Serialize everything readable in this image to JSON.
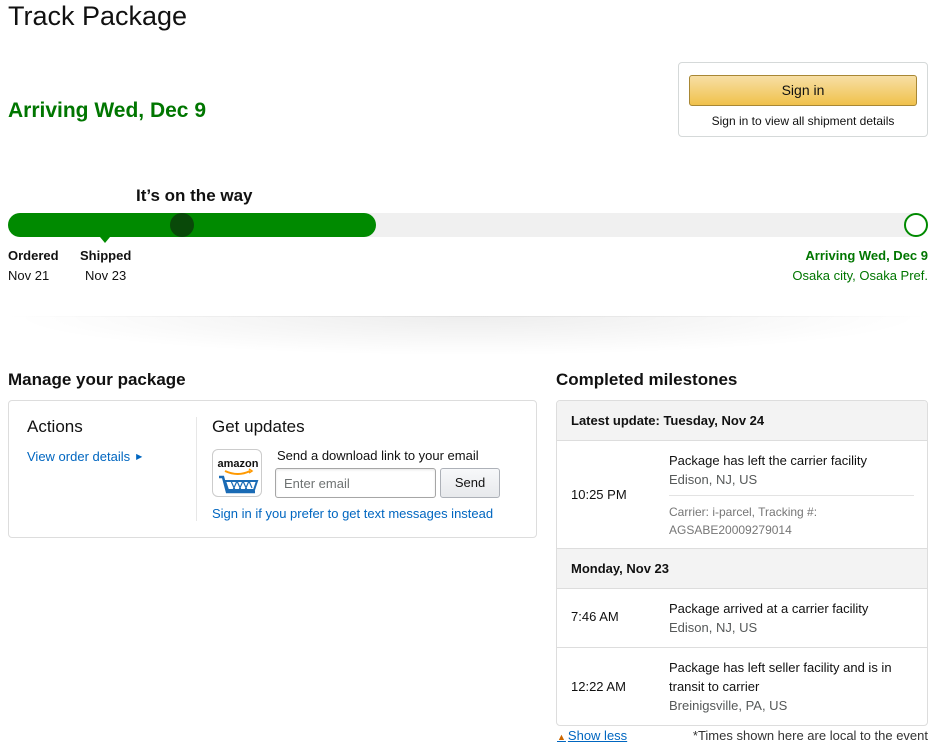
{
  "header": {
    "title": "Track Package",
    "arriving": "Arriving Wed, Dec 9"
  },
  "signin": {
    "button_label": "Sign in",
    "hint": "Sign in to view all shipment details"
  },
  "progress": {
    "status": "It’s on the way",
    "fill_fraction": 0.4,
    "steps": [
      {
        "label": "Ordered",
        "date": "Nov 21"
      },
      {
        "label": "Shipped",
        "date": "Nov 23"
      }
    ],
    "destination": {
      "label": "Arriving Wed, Dec 9",
      "place": "Osaka city, Osaka Pref."
    }
  },
  "manage": {
    "title": "Manage your package",
    "actions_title": "Actions",
    "view_order": "View order details",
    "updates_title": "Get updates",
    "send_hint": "Send a download link to your email",
    "email_placeholder": "Enter email",
    "send_label": "Send",
    "text_link": "Sign in if you prefer to get text messages instead",
    "app_icon_text": "amazon"
  },
  "milestones": {
    "title": "Completed milestones",
    "days": [
      {
        "header": "Latest update: Tuesday, Nov 24",
        "events": [
          {
            "time": "10:25 PM",
            "desc": "Package has left the carrier facility",
            "location": "Edison, NJ, US",
            "meta": "Carrier: i-parcel, Tracking #: AGSABE20009279014"
          }
        ]
      },
      {
        "header": "Monday, Nov 23",
        "events": [
          {
            "time": "7:46 AM",
            "desc": "Package arrived at a carrier facility",
            "location": "Edison, NJ, US"
          },
          {
            "time": "12:22 AM",
            "desc": "Package has left seller facility and is in transit to carrier",
            "location": "Breinigsville, PA, US"
          }
        ]
      }
    ],
    "show_less": "Show less",
    "times_note": "*Times shown here are local to the event"
  },
  "colors": {
    "green": "#007600",
    "progress_green": "#008a00",
    "link_blue": "#0066c0",
    "signin_yellow": "#f0c14b"
  }
}
